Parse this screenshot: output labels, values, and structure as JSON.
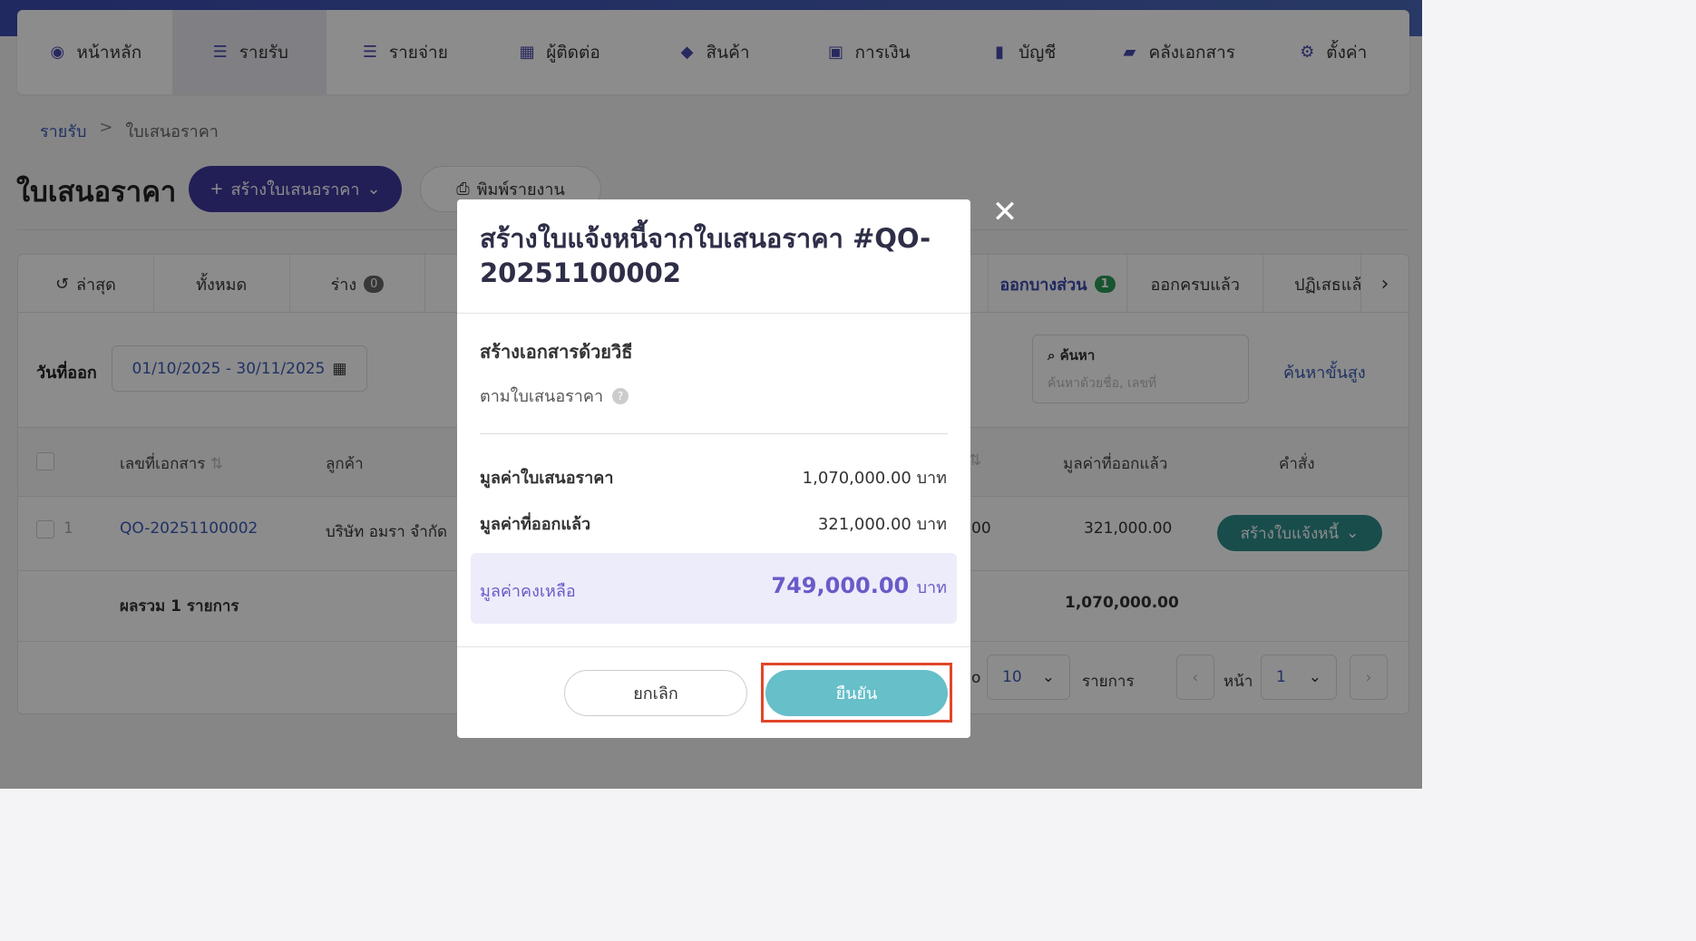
{
  "nav": [
    {
      "label": "หน้าหลัก",
      "icon": "dashboard-icon",
      "glyph": "◉"
    },
    {
      "label": "รายรับ",
      "icon": "income-list-icon",
      "glyph": "☰",
      "active": true
    },
    {
      "label": "รายจ่าย",
      "icon": "expense-list-icon",
      "glyph": "☰"
    },
    {
      "label": "ผู้ติดต่อ",
      "icon": "contacts-icon",
      "glyph": "▦"
    },
    {
      "label": "สินค้า",
      "icon": "box-icon",
      "glyph": "◆"
    },
    {
      "label": "การเงิน",
      "icon": "money-icon",
      "glyph": "▣"
    },
    {
      "label": "บัญชี",
      "icon": "book-icon",
      "glyph": "▮"
    },
    {
      "label": "คลังเอกสาร",
      "icon": "folder-icon",
      "glyph": "▰"
    },
    {
      "label": "ตั้งค่า",
      "icon": "gear-icon",
      "glyph": "⚙"
    }
  ],
  "breadcrumb": {
    "parent": "รายรับ",
    "sep": ">",
    "current": "ใบเสนอราคา"
  },
  "page_title": "ใบเสนอราคา",
  "create_button": "สร้างใบเสนอราคา",
  "print_button": "พิมพ์รายงาน",
  "tabs": {
    "latest": "ล่าสุด",
    "all": "ทั้งหมด",
    "draft": "ร่าง",
    "draft_count": "0",
    "partial": "ออกบางส่วน",
    "partial_count": "1",
    "complete": "ออกครบแล้ว",
    "rejected": "ปฏิเสธแล้ว"
  },
  "filter": {
    "date_label": "วันที่ออก",
    "date_range": "01/10/2025 - 30/11/2025",
    "search_label": "ค้นหา",
    "search_placeholder": "ค้นหาด้วยชื่อ, เลขที่",
    "advanced": "ค้นหาขั้นสูง"
  },
  "table": {
    "headers": {
      "doc_no": "เลขที่เอกสาร",
      "customer": "ลูกค้า",
      "issued_value": "มูลค่าที่ออกแล้ว",
      "action": "คำสั่ง"
    },
    "row": {
      "index": "1",
      "doc_no": "QO-20251100002",
      "customer": "บริษัท อมรา จำกัด",
      "partial_col": "00",
      "issued_value": "321,000.00",
      "action_button": "สร้างใบแจ้งหนี้"
    },
    "summary": {
      "label": "ผลรวม 1 รายการ",
      "total": "1,070,000.00"
    }
  },
  "pager": {
    "per_page": "10",
    "per_page_label": "รายการ",
    "page_label": "หน้า",
    "page": "1",
    "show_prefix": "o"
  },
  "modal": {
    "title": "สร้างใบแจ้งหนี้จากใบเสนอราคา #QO-20251100002",
    "subtitle": "สร้างเอกสารด้วยวิธี",
    "method": "ตามใบเสนอราคา",
    "quote_value_label": "มูลค่าใบเสนอราคา",
    "quote_value": "1,070,000.00 บาท",
    "issued_label": "มูลค่าที่ออกแล้ว",
    "issued_value": "321,000.00 บาท",
    "remaining_label": "มูลค่าคงเหลือ",
    "remaining_value": "749,000.00",
    "currency": "บาท",
    "cancel": "ยกเลิก",
    "confirm": "ยืนยัน"
  }
}
